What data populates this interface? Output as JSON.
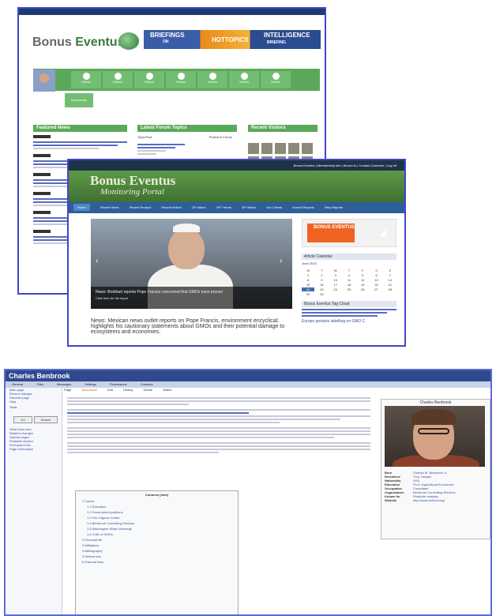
{
  "window1": {
    "logo": {
      "part1": "Bonus ",
      "part2": "Eventus"
    },
    "banner": {
      "left": "BRIEFINGS",
      "left_small": "ON",
      "middle": "HOTTOPICS",
      "right": "INTELLIGENCE",
      "right_small": "BRIEFING"
    },
    "icon_tiles": [
      "Videos",
      "Videos",
      "Videos",
      "Videos",
      "Videos",
      "Videos",
      "Videos",
      "Videos"
    ],
    "extra_tile": "Bookmarks",
    "featured_news": "Featured News",
    "latest_forum_topics": "Latest Forum Topics",
    "forum_cols": [
      "Topic/Post",
      "Posted in Forum"
    ],
    "recent_visitors": "Recent Visitors"
  },
  "window2": {
    "topnav": "Bonus Eventus  |  Membership Info  |  About Us  |  Contact Customer  |  Log off",
    "title": "Bonus Eventus",
    "subtitle": "Monitoring Portal",
    "nav": [
      "Home",
      "Recent News",
      "Recent Product",
      "Recent Notice",
      "OP Watch",
      "OP Trends",
      "OP Watch",
      "Our Clients",
      "Annual Reports",
      "Help Reports"
    ],
    "slide_caption": "News: Breitbart reports Pope Francis concerned that GMOs have proven",
    "slide_subcaption": "Click here for full report",
    "story_title": "News: Mexican news outlet reports on Pope Francis, environment encyclical; highlights his cautionary statements about GMOs and their potential damage to ecosystems and economies.",
    "sidebar_card": "BONUS EVENTUS",
    "calendar_title": "Article Calendar",
    "calendar_month": "June 2015",
    "calendar_days": [
      "M",
      "T",
      "W",
      "T",
      "F",
      "S",
      "S"
    ],
    "calendar_dates": [
      "1",
      "2",
      "3",
      "4",
      "5",
      "6",
      "7",
      "8",
      "9",
      "10",
      "11",
      "12",
      "13",
      "14",
      "15",
      "16",
      "17",
      "18",
      "19",
      "20",
      "21",
      "22",
      "23",
      "24",
      "25",
      "26",
      "27",
      "28",
      "29",
      "30"
    ],
    "calendar_selected": "22",
    "tag_cloud_title": "Bonus Eventus Tag Cloud",
    "sidebar_note": "Europe pertains labelling on GMO C"
  },
  "window3": {
    "title": "Charles Benbrook",
    "menu": [
      "General",
      "Files",
      "Messages",
      "Settings",
      "Permissions",
      "Contacts"
    ],
    "leftnav": [
      "Main page",
      "Recent changes",
      "Random page",
      "Help",
      "Tools",
      "What links here",
      "Related changes",
      "Special pages",
      "Printable version",
      "Permanent link",
      "Page information"
    ],
    "search_button": "Go",
    "search_button2": "Search",
    "tabs": [
      "Page",
      "Discussion",
      "Edit",
      "History",
      "Delete",
      "Watch"
    ],
    "infobox_title": "Charles Benbrook",
    "infobox_rows": [
      {
        "k": "Born",
        "v": "Charles M. Benbrook Jr."
      },
      {
        "k": "Residence",
        "v": "Troy, Oregon"
      },
      {
        "k": "Nationality",
        "v": "USA"
      },
      {
        "k": "Education",
        "v": "Ph.D. Agricultural Economics"
      },
      {
        "k": "Occupation",
        "v": "Consultant"
      },
      {
        "k": "Organization",
        "v": "Benbrook Consulting Services"
      },
      {
        "k": "Known for",
        "v": "Pesticide analysis"
      },
      {
        "k": "Website",
        "v": "http://www.hortcrit.org/"
      }
    ],
    "toc_title": "Contents [hide]",
    "toc": [
      {
        "t": "1 Career",
        "s": false
      },
      {
        "t": "1.1 Education",
        "s": true
      },
      {
        "t": "1.2 Government positions",
        "s": true
      },
      {
        "t": "1.3 The Organic Center",
        "s": true
      },
      {
        "t": "1.4 Benbrook Consulting Services",
        "s": true
      },
      {
        "t": "1.5 Washington State University",
        "s": true
      },
      {
        "t": "1.6 Critic of GMOs",
        "s": true
      },
      {
        "t": "2 Personal life",
        "s": false
      },
      {
        "t": "3 Affiliations",
        "s": false
      },
      {
        "t": "4 Bibliography",
        "s": false
      },
      {
        "t": "5 References",
        "s": false
      },
      {
        "t": "6 External links",
        "s": false
      }
    ]
  }
}
